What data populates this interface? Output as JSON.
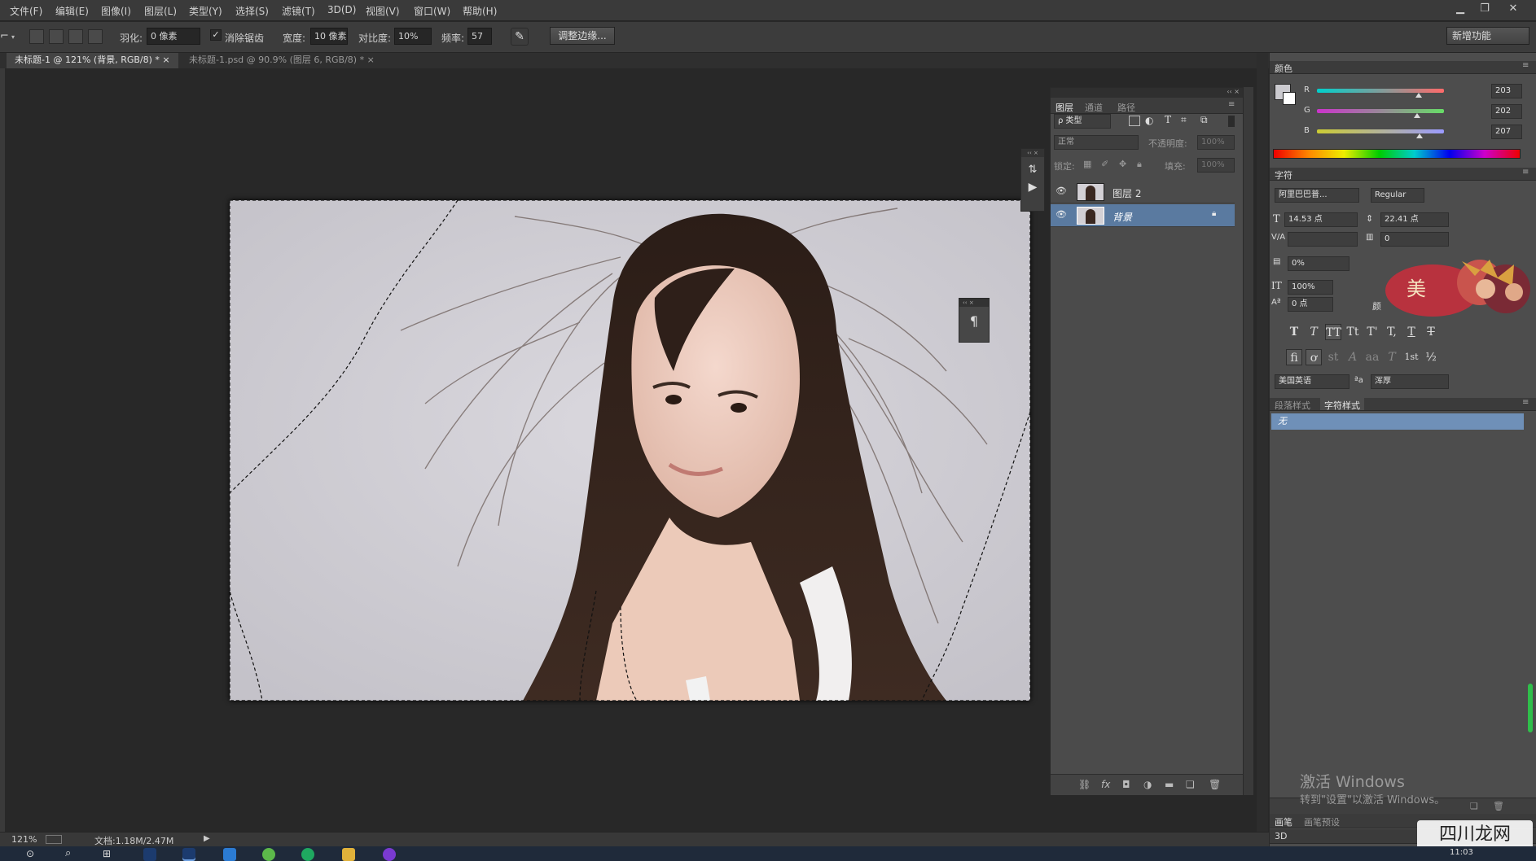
{
  "menu": [
    "文件(F)",
    "编辑(E)",
    "图像(I)",
    "图层(L)",
    "类型(Y)",
    "选择(S)",
    "滤镜(T)",
    "3D(D)",
    "视图(V)",
    "窗口(W)",
    "帮助(H)"
  ],
  "options": {
    "feather_label": "羽化:",
    "feather_value": "0 像素",
    "antialias_label": "消除锯齿",
    "width_label": "宽度:",
    "width_value": "10 像素",
    "contrast_label": "对比度:",
    "contrast_value": "10%",
    "frequency_label": "频率:",
    "frequency_value": "57",
    "refine_edge_button": "调整边缘...",
    "workspace_select": "新增功能"
  },
  "tabs": [
    "未标题-1 @ 121% (背景, RGB/8) *",
    "未标题-1.psd @ 90.9% (图层 6, RGB/8) *"
  ],
  "layers_panel": {
    "tabs": [
      "图层",
      "通道",
      "路径"
    ],
    "filter_label": "ρ 类型",
    "blend_mode": "正常",
    "opacity_label": "不透明度:",
    "opacity_value": "100%",
    "lock_label": "锁定:",
    "fill_label": "填充:",
    "fill_value": "100%",
    "layers": [
      {
        "name": "图层 2"
      },
      {
        "name": "背景"
      }
    ],
    "footer_icons": [
      "link-icon",
      "fx-icon",
      "mask-icon",
      "adjustment-icon",
      "folder-icon",
      "new-layer-icon",
      "trash-icon"
    ]
  },
  "color_panel": {
    "title": "颜色",
    "channels": [
      {
        "label": "R",
        "value": "203",
        "position": 0.8
      },
      {
        "label": "G",
        "value": "202",
        "position": 0.79
      },
      {
        "label": "B",
        "value": "207",
        "position": 0.81
      }
    ]
  },
  "character_panel": {
    "title": "字符",
    "font_family": "阿里巴巴普...",
    "font_style": "Regular",
    "font_size": "14.53 点",
    "leading": "22.41 点",
    "kerning": "",
    "tracking": "0",
    "tsume": "0%",
    "vertical_scale": "100%",
    "baseline_shift": "0 点",
    "color_label": "颜",
    "language": "美国英语",
    "aa_label": "ªa",
    "antialias": "浑厚",
    "glyph_row1": [
      "T",
      "T",
      "TT",
      "Tt",
      "T'",
      "T,",
      "T",
      "T"
    ],
    "glyph_row2": [
      "fi",
      "ơ",
      "st",
      "A",
      "aa",
      "T",
      "1st",
      "½"
    ]
  },
  "styles_panel": {
    "tabs": [
      "段落样式",
      "字符样式"
    ],
    "item": "无"
  },
  "bottom_tabs": [
    "画笔",
    "画笔预设"
  ],
  "bottom_3d": "3D",
  "status": {
    "zoom": "121%",
    "doc": "文档:1.18M/2.47M"
  },
  "watermark": {
    "line1": "激活 Windows",
    "line2": "转到\"设置\"以激活 Windows。"
  },
  "taskbar_time": "11:03",
  "site_logo": "四川龙网",
  "colors": {
    "accent": "#4f6d91",
    "menu_bg": "#3a3a3a",
    "panel_bg": "#4b4b4b",
    "canvas_bg": "#282828"
  }
}
